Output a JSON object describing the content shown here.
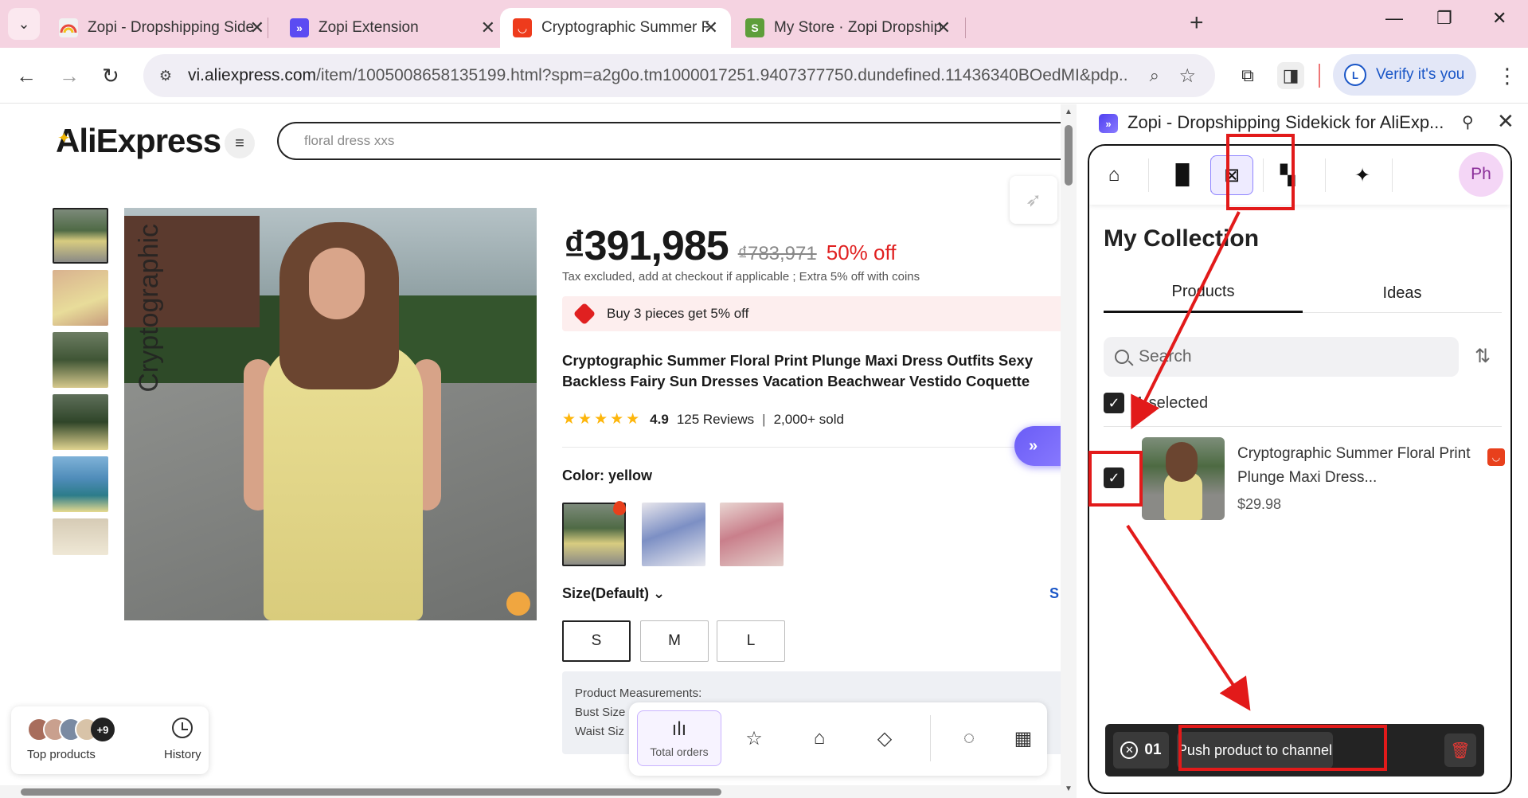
{
  "browser": {
    "tabs": [
      {
        "title": "Zopi - Dropshipping Sidekick fo",
        "fav": "Z",
        "fav_color": "#e9e9e9"
      },
      {
        "title": "Zopi Extension",
        "fav": "Z",
        "fav_color": "#5b4bf2"
      },
      {
        "title": "Cryptographic Summer Floral P",
        "fav": "A",
        "fav_color": "#ee3b1c"
      },
      {
        "title": "My Store · Zopi Dropshipping ·",
        "fav": "S",
        "fav_color": "#5e9e3a"
      }
    ],
    "url_main": "vi.aliexpress.com",
    "url_rest": "/item/1005008658135199.html?spm=a2g0o.tm1000017251.9407377750.dundefined.11436340BOedMI&pdp...",
    "verify_label": "Verify it's you",
    "verify_avatar": "L"
  },
  "page": {
    "logo": "AliExpress",
    "search_value": "floral dress xxs",
    "price": "₫391,985",
    "price_old": "₫783,971",
    "price_off": "50% off",
    "tax_note": "Tax excluded, add at checkout if applicable ; Extra 5% off with coins",
    "promo": "Buy 3 pieces get 5% off",
    "title_line1": "Cryptographic Summer Floral Print Plunge Maxi Dress Outfits Sexy",
    "title_line2": "Backless Fairy Sun Dresses Vacation Beachwear Vestido Coquette",
    "rating": "4.9",
    "reviews": "125 Reviews",
    "sold": "2,000+ sold",
    "color_label": "Color: yellow",
    "size_label": "Size(Default)",
    "size_link": "S",
    "sizes": [
      "S",
      "M",
      "L"
    ],
    "measure_title": "Product Measurements:",
    "measure_line2": "Bust Size",
    "measure_line3": "Waist Siz",
    "watermark": "Cryptographic",
    "top_products": "Top products",
    "more_count": "+9",
    "history": "History",
    "total_orders": "Total orders"
  },
  "panel": {
    "header_title": "Zopi - Dropshipping Sidekick for AliExp...",
    "avatar": "Ph",
    "collection_title": "My Collection",
    "tabs": [
      "Products",
      "Ideas"
    ],
    "search_placeholder": "Search",
    "selected_text": "1 selected",
    "item_title": "Cryptographic Summer Floral Print Plunge Maxi Dress...",
    "item_price": "$29.98",
    "count": "01",
    "push_button": "Push product to channel"
  },
  "colors": {
    "accent": "#6a5cf6",
    "annotation_red": "#e21a1a",
    "discount_red": "#e02020"
  }
}
